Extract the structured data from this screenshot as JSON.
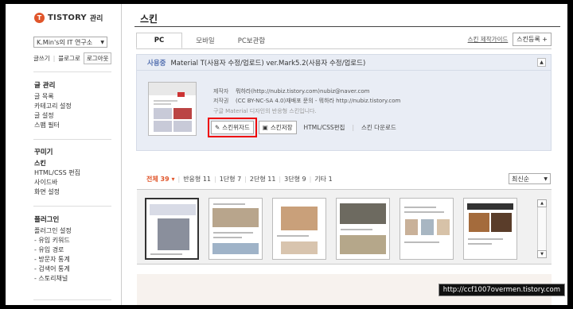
{
  "brand": {
    "mark": "T",
    "name": "TISTORY",
    "sub": "관리"
  },
  "blog_select": {
    "value": "K.Min's의 IT 연구소"
  },
  "mini_links": {
    "posts": "글쓰기",
    "blog": "블로그로",
    "logout": "로그아웃"
  },
  "sidebar": {
    "groups": [
      {
        "title": "글 관리",
        "items": [
          "글 목록",
          "카테고리 설정",
          "글 설정",
          "스팸 필터"
        ]
      },
      {
        "title": "꾸미기",
        "items": [
          "스킨",
          "HTML/CSS 편집",
          "사이드바",
          "화면 설정"
        ],
        "active": "스킨"
      },
      {
        "title": "플러그인",
        "items": [
          "플러그인 설정",
          "- 유입 키워드",
          "- 유입 경로",
          "- 방문자 통계",
          "- 검색어 통계",
          "- 스토리채널"
        ]
      }
    ]
  },
  "page": {
    "title": "스킨"
  },
  "tabs": [
    "PC",
    "모바일",
    "PC보관함"
  ],
  "tab_actions": {
    "guide": "스킨 제작가이드",
    "register": "스킨등록",
    "register_icon": "+"
  },
  "current_skin": {
    "status": "사용중",
    "name": "Material T(사용자 수정/업로드) ver.Mark5.2(사용자 수정/업로드)",
    "author_label": "제작자",
    "author_value": "뭐하라(http://nubiz.tistory.com)nubiz@naver.com",
    "license_label": "저작권",
    "license_value": "(CC BY-NC-SA 4.0)재배포 문의 - 뭐하라 http://nubiz.tistory.com",
    "description": "구글 Material 디자인의 반응형 스킨입니다.",
    "buttons": {
      "wizard": "스킨위자드",
      "save": "스킨저장",
      "html": "HTML/CSS편집",
      "download": "스킨 다운로드"
    }
  },
  "filters": [
    {
      "label": "전체",
      "count": "39",
      "active": true
    },
    {
      "label": "반응형",
      "count": "11"
    },
    {
      "label": "1단형",
      "count": "7"
    },
    {
      "label": "2단형",
      "count": "11"
    },
    {
      "label": "3단형",
      "count": "9"
    },
    {
      "label": "기타",
      "count": "1"
    }
  ],
  "sort": {
    "value": "최신순"
  },
  "watermark": "http://ccf1007overmen.tistory.com",
  "colors": {
    "accent": "#e0552a",
    "panel": "#e9edf5",
    "status": "#5470b0",
    "highlight": "#ee0000"
  }
}
